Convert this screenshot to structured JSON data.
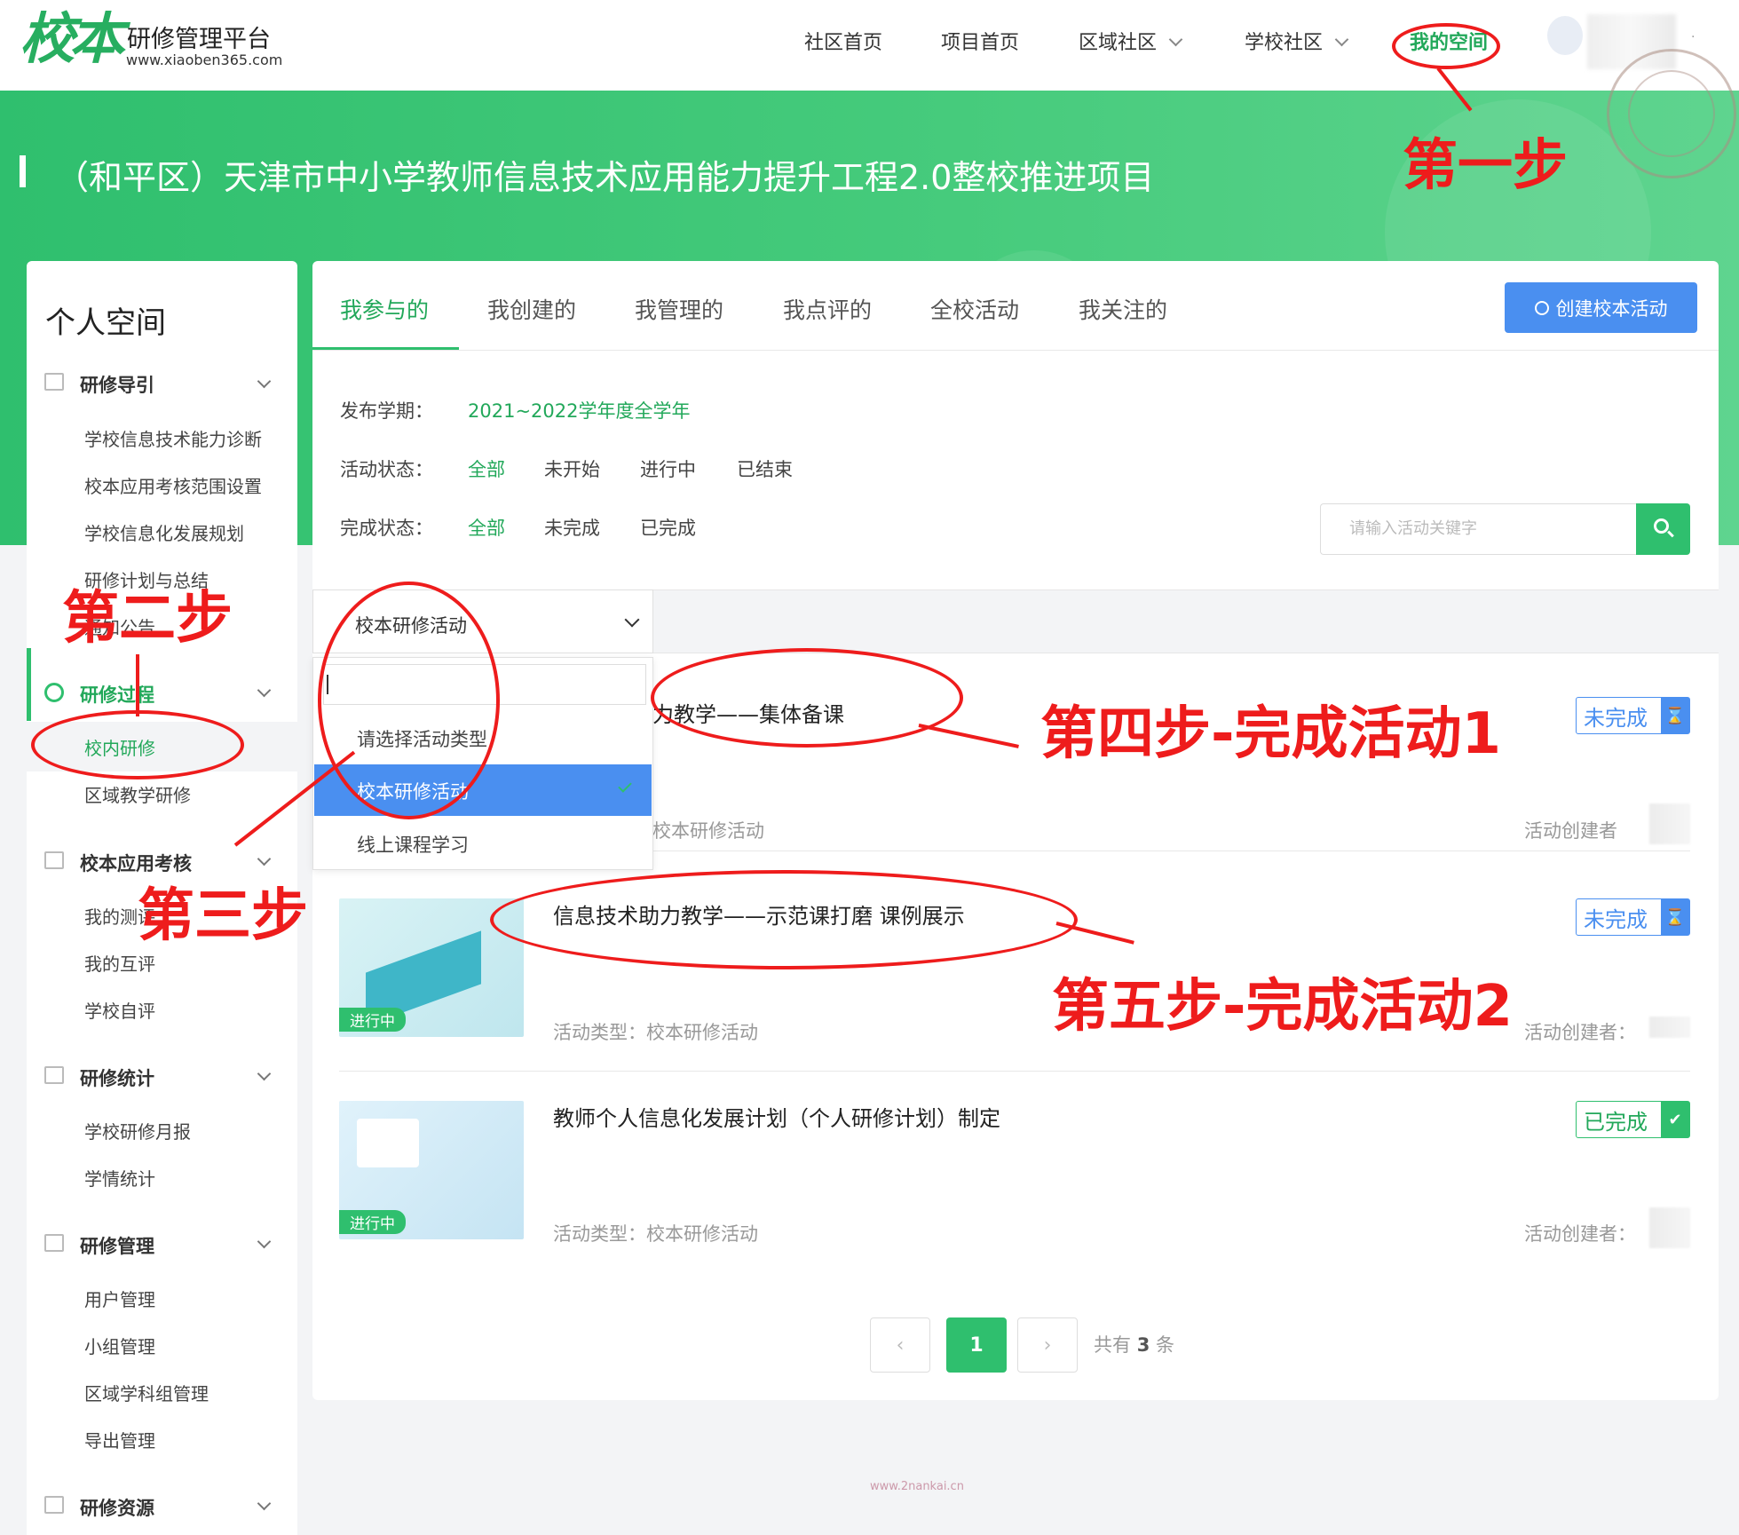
{
  "header": {
    "logo_glyph": "校本",
    "logo_title": "研修管理平台",
    "logo_url": "www.xiaoben365.com",
    "nav": [
      "社区首页",
      "项目首页",
      "区域社区",
      "学校社区",
      "我的空间"
    ],
    "user_dot": "·"
  },
  "banner": {
    "title": "（和平区）天津市中小学教师信息技术应用能力提升工程2.0整校推进项目"
  },
  "sidebar": {
    "title": "个人空间",
    "groups": [
      {
        "label": "研修导引",
        "items": [
          "学校信息技术能力诊断",
          "校本应用考核范围设置",
          "学校信息化发展规划",
          "研修计划与总结",
          "通知公告"
        ]
      },
      {
        "label": "研修过程",
        "items": [
          "校内研修",
          "区域教学研修"
        ]
      },
      {
        "label": "校本应用考核",
        "items": [
          "我的测评",
          "我的互评",
          "学校自评"
        ]
      },
      {
        "label": "研修统计",
        "items": [
          "学校研修月报",
          "学情统计"
        ]
      },
      {
        "label": "研修管理",
        "items": [
          "用户管理",
          "小组管理",
          "区域学科组管理",
          "导出管理"
        ]
      },
      {
        "label": "研修资源",
        "items": []
      }
    ]
  },
  "tabs": [
    "我参与的",
    "我创建的",
    "我管理的",
    "我点评的",
    "全校活动",
    "我关注的"
  ],
  "create_button": "创建校本活动",
  "filters": {
    "term_label": "发布学期：",
    "term_value": "2021~2022学年度全学年",
    "status_label": "活动状态：",
    "status_options": [
      "全部",
      "未开始",
      "进行中",
      "已结束"
    ],
    "completion_label": "完成状态：",
    "completion_options": [
      "全部",
      "未完成",
      "已完成"
    ],
    "search_placeholder": "请输入活动关键字"
  },
  "type_select": {
    "selected": "校本研修活动",
    "options": [
      "请选择活动类型",
      "校本研修活动",
      "线上课程学习"
    ]
  },
  "activities": [
    {
      "title": "力教学——集体备课",
      "type": "校本研修活动",
      "status": "未完成",
      "creator_label": "活动创建者"
    },
    {
      "title": "信息技术助力教学——示范课打磨 课例展示",
      "type": "活动类型：校本研修活动",
      "status": "未完成",
      "state_tag": "进行中",
      "creator_label": "活动创建者："
    },
    {
      "title": "教师个人信息化发展计划（个人研修计划）制定",
      "type": "活动类型：校本研修活动",
      "status": "已完成",
      "state_tag": "进行中",
      "creator_label": "活动创建者："
    }
  ],
  "pagination": {
    "current": "1",
    "total_prefix": "共有",
    "total_count": "3",
    "total_suffix": "条"
  },
  "footer_url": "www.2nankai.cn",
  "annotations": {
    "step1": "第一步",
    "step2": "第二步",
    "step3": "第三步",
    "step4": "第四步-完成活动1",
    "step5": "第五步-完成活动2"
  },
  "colors": {
    "brand_green": "#2fbf6e",
    "accent_blue": "#4a8ff0",
    "annotation_red": "#ee1c1c"
  }
}
